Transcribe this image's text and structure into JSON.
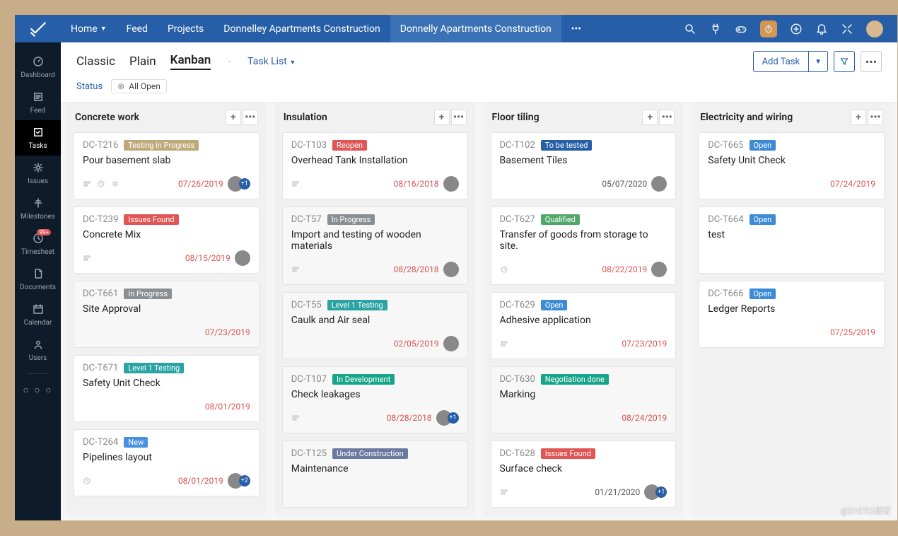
{
  "top": {
    "home": "Home",
    "feed": "Feed",
    "projects": "Projects",
    "crumb1": "Donnelley Apartments Construction",
    "crumb2": "Donnelly Apartments Construction"
  },
  "sidebar": {
    "dashboard": "Dashboard",
    "feed": "Feed",
    "tasks": "Tasks",
    "issues": "Issues",
    "milestones": "Milestones",
    "timesheet": "Timesheet",
    "timesheet_badge": "99+",
    "documents": "Documents",
    "calendar": "Calendar",
    "users": "Users"
  },
  "views": {
    "classic": "Classic",
    "plain": "Plain",
    "kanban": "Kanban",
    "dropdown": "Task List",
    "addtask": "Add Task"
  },
  "filter": {
    "label": "Status",
    "chip": "All Open"
  },
  "columns": [
    {
      "title": "Concrete work",
      "cards": [
        {
          "id": "DC-T216",
          "tag": "Testing in Progress",
          "tagcls": "t-tan",
          "title": "Pour basement slab",
          "date": "07/26/2019",
          "icons": [
            "sub",
            "clock",
            "bug"
          ],
          "av": true,
          "plus": "+1"
        },
        {
          "id": "DC-T239",
          "tag": "Issues Found",
          "tagcls": "t-red",
          "title": "Concrete Mix",
          "date": "08/15/2019",
          "icons": [
            "sub"
          ],
          "av": true
        },
        {
          "id": "DC-T661",
          "tag": "In Progress",
          "tagcls": "t-gray",
          "title": "Site Approval",
          "date": "07/23/2019",
          "faded": true
        },
        {
          "id": "DC-T671",
          "tag": "Level 1 Testing",
          "tagcls": "t-teal",
          "title": "Safety Unit Check",
          "date": "08/01/2019"
        },
        {
          "id": "DC-T264",
          "tag": "New",
          "tagcls": "t-new",
          "title": "Pipelines layout",
          "date": "08/01/2019",
          "icons": [
            "clock"
          ],
          "av": true,
          "plus": "+2"
        }
      ]
    },
    {
      "title": "Insulation",
      "cards": [
        {
          "id": "DC-T103",
          "tag": "Reopen",
          "tagcls": "t-red",
          "title": "Overhead Tank Installation",
          "date": "08/16/2018",
          "icons": [
            "sub"
          ],
          "av": true
        },
        {
          "id": "DC-T57",
          "tag": "In Progress",
          "tagcls": "t-gray",
          "title": "Import and testing of wooden materials",
          "date": "08/28/2018",
          "icons": [
            "sub"
          ],
          "av": true,
          "faded": true
        },
        {
          "id": "DC-T55",
          "tag": "Level 1 Testing",
          "tagcls": "t-teal",
          "title": "Caulk and Air seal",
          "date": "02/05/2019",
          "av": true,
          "faded": true
        },
        {
          "id": "DC-T107",
          "tag": "In Development",
          "tagcls": "t-teal2",
          "title": "Check leakages",
          "date": "08/28/2018",
          "icons": [
            "sub"
          ],
          "av": true,
          "plus": "+1",
          "faded": true
        },
        {
          "id": "DC-T125",
          "tag": "Under Construction",
          "tagcls": "t-purple",
          "title": "Maintenance",
          "date": "",
          "faded": true
        }
      ]
    },
    {
      "title": "Floor tiling",
      "cards": [
        {
          "id": "DC-T102",
          "tag": "To be tested",
          "tagcls": "t-blue",
          "title": "Basement Tiles",
          "date": "05/07/2020",
          "datecls": "dark",
          "av": true
        },
        {
          "id": "DC-T627",
          "tag": "Qualified",
          "tagcls": "t-green",
          "title": "Transfer of goods from storage to site.",
          "date": "08/22/2019",
          "icons": [
            "clock"
          ],
          "av": true
        },
        {
          "id": "DC-T629",
          "tag": "Open",
          "tagcls": "t-open",
          "title": "Adhesive application",
          "date": "07/23/2019",
          "icons": [
            "sub"
          ]
        },
        {
          "id": "DC-T630",
          "tag": "Negotiation done",
          "tagcls": "t-teal2",
          "title": "Marking",
          "date": "08/24/2019",
          "faded": true
        },
        {
          "id": "DC-T628",
          "tag": "Issues Found",
          "tagcls": "t-red",
          "title": "Surface check",
          "date": "01/21/2020",
          "datecls": "dark",
          "icons": [
            "sub"
          ],
          "av": true,
          "plus": "+1"
        }
      ]
    },
    {
      "title": "Electricity and wiring",
      "cards": [
        {
          "id": "DC-T665",
          "tag": "Open",
          "tagcls": "t-open",
          "title": "Safety Unit Check",
          "date": "07/24/2019"
        },
        {
          "id": "DC-T664",
          "tag": "Open",
          "tagcls": "t-open",
          "title": "test",
          "date": ""
        },
        {
          "id": "DC-T666",
          "tag": "Open",
          "tagcls": "t-open",
          "title": "Ledger Reports",
          "date": "07/25/2019"
        }
      ]
    }
  ],
  "watermark": "@51CTO博客"
}
